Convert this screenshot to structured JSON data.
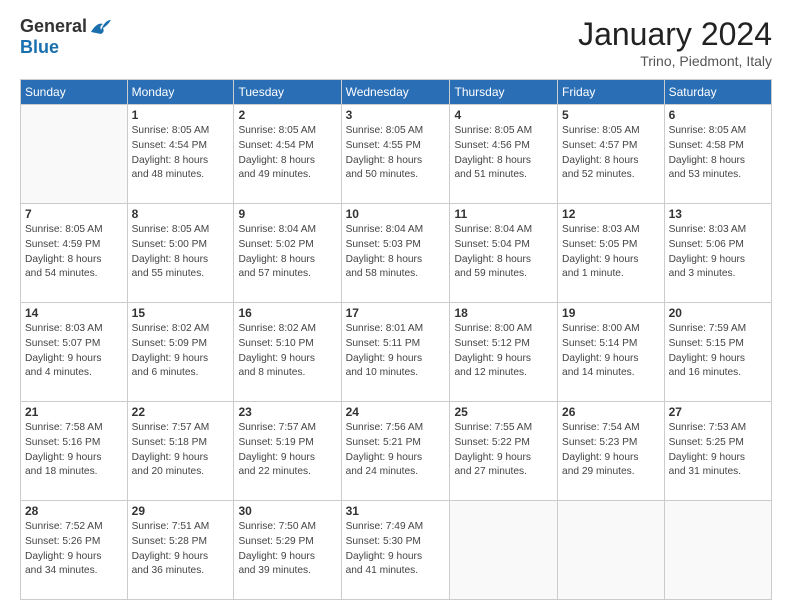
{
  "logo": {
    "general": "General",
    "blue": "Blue"
  },
  "title": "January 2024",
  "location": "Trino, Piedmont, Italy",
  "weekdays": [
    "Sunday",
    "Monday",
    "Tuesday",
    "Wednesday",
    "Thursday",
    "Friday",
    "Saturday"
  ],
  "weeks": [
    [
      {
        "day": "",
        "info": ""
      },
      {
        "day": "1",
        "info": "Sunrise: 8:05 AM\nSunset: 4:54 PM\nDaylight: 8 hours\nand 48 minutes."
      },
      {
        "day": "2",
        "info": "Sunrise: 8:05 AM\nSunset: 4:54 PM\nDaylight: 8 hours\nand 49 minutes."
      },
      {
        "day": "3",
        "info": "Sunrise: 8:05 AM\nSunset: 4:55 PM\nDaylight: 8 hours\nand 50 minutes."
      },
      {
        "day": "4",
        "info": "Sunrise: 8:05 AM\nSunset: 4:56 PM\nDaylight: 8 hours\nand 51 minutes."
      },
      {
        "day": "5",
        "info": "Sunrise: 8:05 AM\nSunset: 4:57 PM\nDaylight: 8 hours\nand 52 minutes."
      },
      {
        "day": "6",
        "info": "Sunrise: 8:05 AM\nSunset: 4:58 PM\nDaylight: 8 hours\nand 53 minutes."
      }
    ],
    [
      {
        "day": "7",
        "info": "Sunrise: 8:05 AM\nSunset: 4:59 PM\nDaylight: 8 hours\nand 54 minutes."
      },
      {
        "day": "8",
        "info": "Sunrise: 8:05 AM\nSunset: 5:00 PM\nDaylight: 8 hours\nand 55 minutes."
      },
      {
        "day": "9",
        "info": "Sunrise: 8:04 AM\nSunset: 5:02 PM\nDaylight: 8 hours\nand 57 minutes."
      },
      {
        "day": "10",
        "info": "Sunrise: 8:04 AM\nSunset: 5:03 PM\nDaylight: 8 hours\nand 58 minutes."
      },
      {
        "day": "11",
        "info": "Sunrise: 8:04 AM\nSunset: 5:04 PM\nDaylight: 8 hours\nand 59 minutes."
      },
      {
        "day": "12",
        "info": "Sunrise: 8:03 AM\nSunset: 5:05 PM\nDaylight: 9 hours\nand 1 minute."
      },
      {
        "day": "13",
        "info": "Sunrise: 8:03 AM\nSunset: 5:06 PM\nDaylight: 9 hours\nand 3 minutes."
      }
    ],
    [
      {
        "day": "14",
        "info": "Sunrise: 8:03 AM\nSunset: 5:07 PM\nDaylight: 9 hours\nand 4 minutes."
      },
      {
        "day": "15",
        "info": "Sunrise: 8:02 AM\nSunset: 5:09 PM\nDaylight: 9 hours\nand 6 minutes."
      },
      {
        "day": "16",
        "info": "Sunrise: 8:02 AM\nSunset: 5:10 PM\nDaylight: 9 hours\nand 8 minutes."
      },
      {
        "day": "17",
        "info": "Sunrise: 8:01 AM\nSunset: 5:11 PM\nDaylight: 9 hours\nand 10 minutes."
      },
      {
        "day": "18",
        "info": "Sunrise: 8:00 AM\nSunset: 5:12 PM\nDaylight: 9 hours\nand 12 minutes."
      },
      {
        "day": "19",
        "info": "Sunrise: 8:00 AM\nSunset: 5:14 PM\nDaylight: 9 hours\nand 14 minutes."
      },
      {
        "day": "20",
        "info": "Sunrise: 7:59 AM\nSunset: 5:15 PM\nDaylight: 9 hours\nand 16 minutes."
      }
    ],
    [
      {
        "day": "21",
        "info": "Sunrise: 7:58 AM\nSunset: 5:16 PM\nDaylight: 9 hours\nand 18 minutes."
      },
      {
        "day": "22",
        "info": "Sunrise: 7:57 AM\nSunset: 5:18 PM\nDaylight: 9 hours\nand 20 minutes."
      },
      {
        "day": "23",
        "info": "Sunrise: 7:57 AM\nSunset: 5:19 PM\nDaylight: 9 hours\nand 22 minutes."
      },
      {
        "day": "24",
        "info": "Sunrise: 7:56 AM\nSunset: 5:21 PM\nDaylight: 9 hours\nand 24 minutes."
      },
      {
        "day": "25",
        "info": "Sunrise: 7:55 AM\nSunset: 5:22 PM\nDaylight: 9 hours\nand 27 minutes."
      },
      {
        "day": "26",
        "info": "Sunrise: 7:54 AM\nSunset: 5:23 PM\nDaylight: 9 hours\nand 29 minutes."
      },
      {
        "day": "27",
        "info": "Sunrise: 7:53 AM\nSunset: 5:25 PM\nDaylight: 9 hours\nand 31 minutes."
      }
    ],
    [
      {
        "day": "28",
        "info": "Sunrise: 7:52 AM\nSunset: 5:26 PM\nDaylight: 9 hours\nand 34 minutes."
      },
      {
        "day": "29",
        "info": "Sunrise: 7:51 AM\nSunset: 5:28 PM\nDaylight: 9 hours\nand 36 minutes."
      },
      {
        "day": "30",
        "info": "Sunrise: 7:50 AM\nSunset: 5:29 PM\nDaylight: 9 hours\nand 39 minutes."
      },
      {
        "day": "31",
        "info": "Sunrise: 7:49 AM\nSunset: 5:30 PM\nDaylight: 9 hours\nand 41 minutes."
      },
      {
        "day": "",
        "info": ""
      },
      {
        "day": "",
        "info": ""
      },
      {
        "day": "",
        "info": ""
      }
    ]
  ]
}
